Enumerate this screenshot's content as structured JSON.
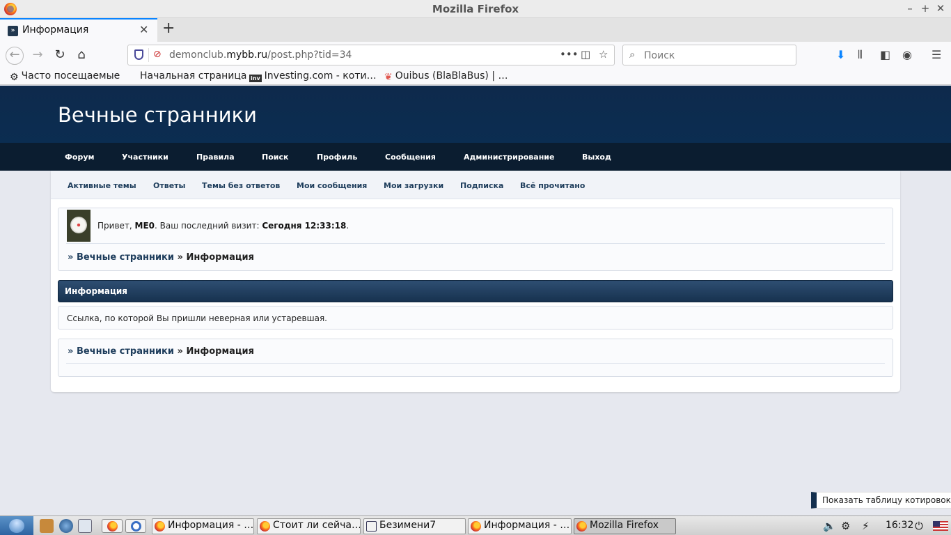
{
  "window": {
    "title": "Mozilla Firefox"
  },
  "tabs": [
    {
      "label": "Информация",
      "active": true
    }
  ],
  "navbar": {
    "url_domain_prefix": "demonclub.",
    "url_domain": "mybb.ru",
    "url_path": "/post.php?tid=34",
    "search_placeholder": "Поиск"
  },
  "bookmarks": [
    {
      "label": "Часто посещаемые",
      "icon": "gear-icon"
    },
    {
      "label": "Начальная страница",
      "icon": ""
    },
    {
      "label": "Investing.com - коти…",
      "icon": "investing-icon"
    },
    {
      "label": "Ouibus (BlaBlaBus) | …",
      "icon": "ouibus-icon"
    }
  ],
  "forum": {
    "title": "Вечные странники",
    "menu": [
      "Форум",
      "Участники",
      "Правила",
      "Поиск",
      "Профиль",
      "Сообщения",
      "Администрирование",
      "Выход"
    ],
    "submenu": [
      "Активные темы",
      "Ответы",
      "Темы без ответов",
      "Мои сообщения",
      "Мои загрузки",
      "Подписка",
      "Всё прочитано"
    ],
    "welcome": {
      "greeting": "Привет, ",
      "username": "ME0",
      "last_visit_label": ".  Ваш последний визит: ",
      "last_visit_value": "Сегодня 12:33:18",
      "end": "."
    },
    "breadcrumb": {
      "sep": "»",
      "home": "Вечные странники",
      "current": "Информация"
    },
    "info_header": "Информация",
    "info_message": "Ссылка, по которой Вы пришли неверная или устаревшая."
  },
  "tooltip": "Показать таблицу котировок",
  "taskbar": {
    "tasks": [
      {
        "label": "Информация - …",
        "active": false
      },
      {
        "label": "Стоит ли сейча…",
        "active": false
      },
      {
        "label": "Безимени7",
        "active": false
      },
      {
        "label": "Информация - …",
        "active": false
      },
      {
        "label": "Mozilla Firefox",
        "active": true
      }
    ],
    "clock": "16:32"
  },
  "colors": {
    "header_bg": "#0e2a4c",
    "menu_bg": "#0b1d30",
    "link": "#1e3d5c",
    "accent_tab": "#0a84ff"
  }
}
